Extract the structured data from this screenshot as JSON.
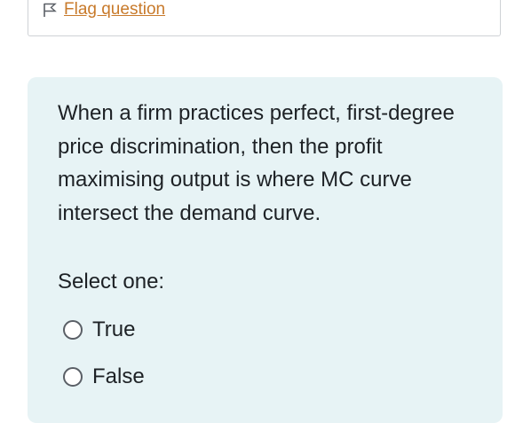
{
  "flag": {
    "label": "Flag question",
    "icon": "flag-outline-icon",
    "color": "#c87a2b"
  },
  "question": {
    "text": "When a firm practices perfect, first-degree price discrimination, then the profit maximising output is where MC curve intersect the demand curve.",
    "prompt": "Select one:",
    "options": [
      {
        "label": "True",
        "selected": false
      },
      {
        "label": "False",
        "selected": false
      }
    ],
    "background_color": "#e7f3f5"
  }
}
